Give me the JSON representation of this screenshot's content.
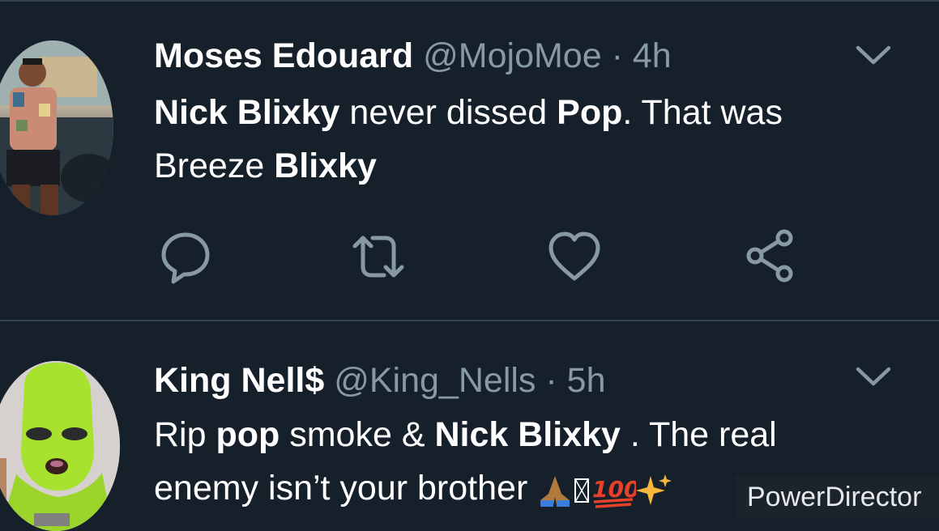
{
  "tweets": [
    {
      "name": "Moses Edouard",
      "handle": "@MojoMoe",
      "separator": "·",
      "time": "4h",
      "body": {
        "line1": [
          {
            "text": "Nick Blixky",
            "bold": true
          },
          {
            "text": " never dissed ",
            "bold": false
          },
          {
            "text": "Pop",
            "bold": true
          },
          {
            "text": ". That was",
            "bold": false
          }
        ],
        "line2": [
          {
            "text": "Breeze ",
            "bold": false
          },
          {
            "text": "Blixky",
            "bold": true
          }
        ]
      }
    },
    {
      "name": "King Nell$",
      "handle": "@King_Nells",
      "separator": "·",
      "time": "5h",
      "body": {
        "line1": [
          {
            "text": "Rip ",
            "bold": false
          },
          {
            "text": "pop",
            "bold": true
          },
          {
            "text": " smoke & ",
            "bold": false
          },
          {
            "text": "Nick Blixky",
            "bold": true
          },
          {
            "text": " . The real",
            "bold": false
          }
        ],
        "line2": [
          {
            "text": "enemy isn’t your brother ",
            "bold": false
          }
        ],
        "emojis": [
          "folded-hands-emoji",
          "missing-glyph",
          "hundred-points-emoji",
          "sparkles-emoji"
        ]
      }
    }
  ],
  "watermark": "PowerDirector",
  "colors": {
    "background": "#15202b",
    "divider": "#38444d",
    "secondary_text": "#8899a6",
    "primary_text": "#ffffff"
  }
}
